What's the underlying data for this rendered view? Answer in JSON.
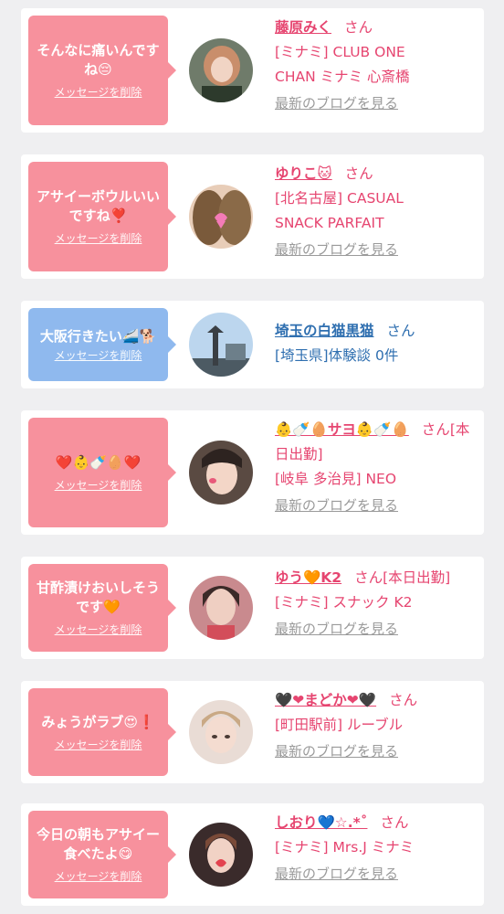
{
  "cards": [
    {
      "message": "そんなに痛いんですね😔",
      "delete_label": "メッセージを削除",
      "name": "藤原みく",
      "san": "さん",
      "shop_line1": "[ミナミ] CLUB ONE",
      "shop_line2": "CHAN ミナミ 心斎橋",
      "blog_label": "最新のブログを見る"
    },
    {
      "message": "アサイーボウルいいですね❣️",
      "delete_label": "メッセージを削除",
      "name": "ゆりこ🐱",
      "san": "さん",
      "shop_line1": "[北名古屋] CASUAL",
      "shop_line2": "SNACK PARFAIT",
      "blog_label": "最新のブログを見る"
    },
    {
      "message": "大阪行きたい🚄🐕",
      "delete_label": "メッセージを削除",
      "name": "埼玉の白猫黒猫",
      "san": "さん",
      "shop_line1": "[埼玉県]体験談 0件"
    },
    {
      "message": "❤️👶🍼🥚❤️",
      "delete_label": "メッセージを削除",
      "name": "👶🍼🥚サヨ👶🍼🥚",
      "san": "さん",
      "status": "[本日出勤]",
      "shop_line1": "[岐阜 多治見] NEO",
      "blog_label": "最新のブログを見る"
    },
    {
      "message": "甘酢漬けおいしそうです🧡",
      "delete_label": "メッセージを削除",
      "name": "ゆう🧡K2",
      "san": "さん",
      "status": "[本日出勤]",
      "shop_line1": "[ミナミ] スナック K2",
      "blog_label": "最新のブログを見る"
    },
    {
      "message": "みょうがラブ😍❗️",
      "delete_label": "メッセージを削除",
      "name": "🖤❤まどか❤🖤",
      "san": "さん",
      "shop_line1": "[町田駅前] ルーブル",
      "blog_label": "最新のブログを見る"
    },
    {
      "message": "今日の朝もアサイー食べたよ😋",
      "delete_label": "メッセージを削除",
      "name": "  しおり💙☆.*˚",
      "san": "さん",
      "shop_line1": "[ミナミ] Mrs.J ミナミ",
      "blog_label": "最新のブログを見る"
    }
  ]
}
